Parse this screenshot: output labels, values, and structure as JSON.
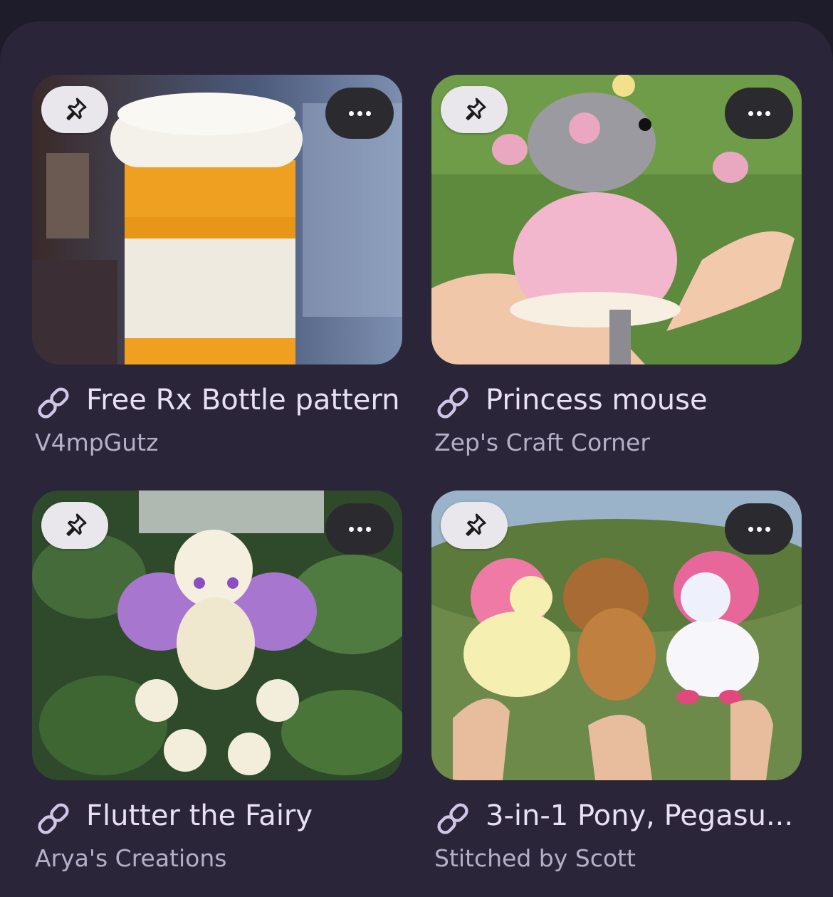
{
  "cards": [
    {
      "title": "Free Rx Bottle pattern",
      "author": "V4mpGutz",
      "pin_icon": "pin-icon",
      "more_icon": "more-horizontal-icon",
      "link_icon": "link-icon"
    },
    {
      "title": "Princess mouse",
      "author": "Zep's Craft Corner",
      "pin_icon": "pin-icon",
      "more_icon": "more-horizontal-icon",
      "link_icon": "link-icon"
    },
    {
      "title": "Flutter the Fairy",
      "author": "Arya's Creations",
      "pin_icon": "pin-icon",
      "more_icon": "more-horizontal-icon",
      "link_icon": "link-icon"
    },
    {
      "title": "3-in-1 Pony, Pegasu...",
      "author": "Stitched by Scott",
      "pin_icon": "pin-icon",
      "more_icon": "more-horizontal-icon",
      "link_icon": "link-icon"
    }
  ],
  "colors": {
    "background": "#1e1b2b",
    "panel": "#2a2539",
    "title_text": "#e7e1f3",
    "author_text": "#b6afc8",
    "pin_button": "#e9e6ec",
    "more_button": "#2b2a2f"
  }
}
